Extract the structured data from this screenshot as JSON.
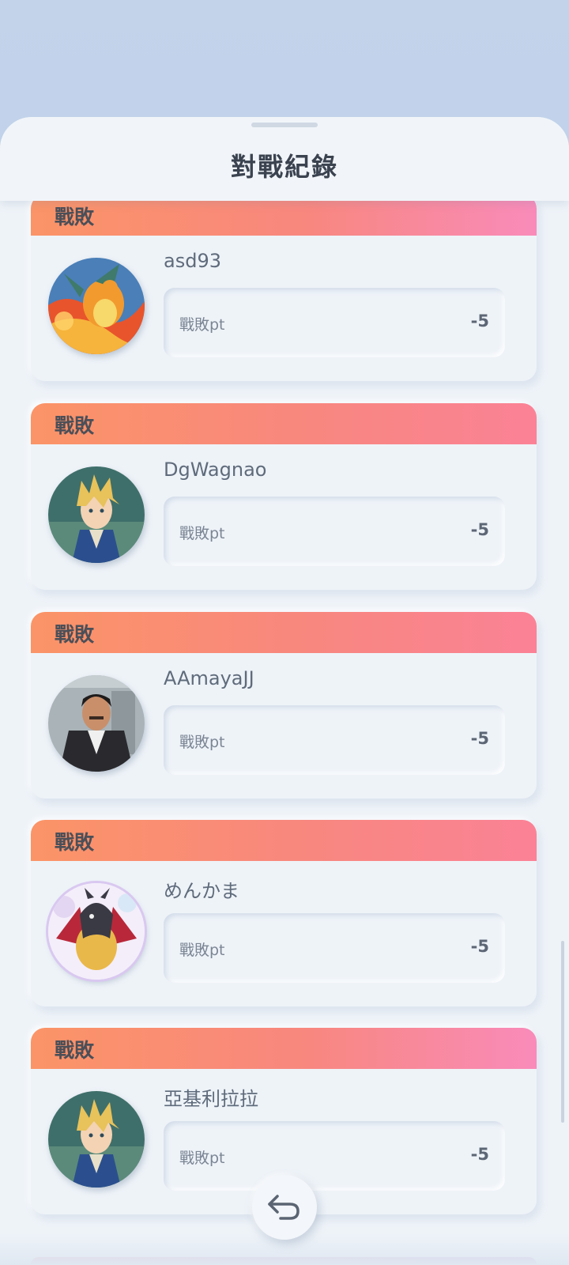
{
  "header": {
    "title": "對戰紀錄"
  },
  "records": [
    {
      "result": "戰敗",
      "player": "asd93",
      "stat_label": "戰敗pt",
      "stat_value": "-5",
      "avatar": "charizard-avatar"
    },
    {
      "result": "戰敗",
      "player": "DgWagnao",
      "stat_label": "戰敗pt",
      "stat_value": "-5",
      "avatar": "trainer-blonde-avatar"
    },
    {
      "result": "戰敗",
      "player": "AAmayaJJ",
      "stat_label": "戰敗pt",
      "stat_value": "-5",
      "avatar": "trainer-suit-avatar"
    },
    {
      "result": "戰敗",
      "player": "めんかま",
      "stat_label": "戰敗pt",
      "stat_value": "-5",
      "avatar": "dragon-avatar"
    },
    {
      "result": "戰敗",
      "player": "亞基利拉拉",
      "stat_label": "戰敗pt",
      "stat_value": "-5",
      "avatar": "trainer-blonde-avatar"
    }
  ],
  "icons": {
    "back": "return-arrow-icon"
  }
}
